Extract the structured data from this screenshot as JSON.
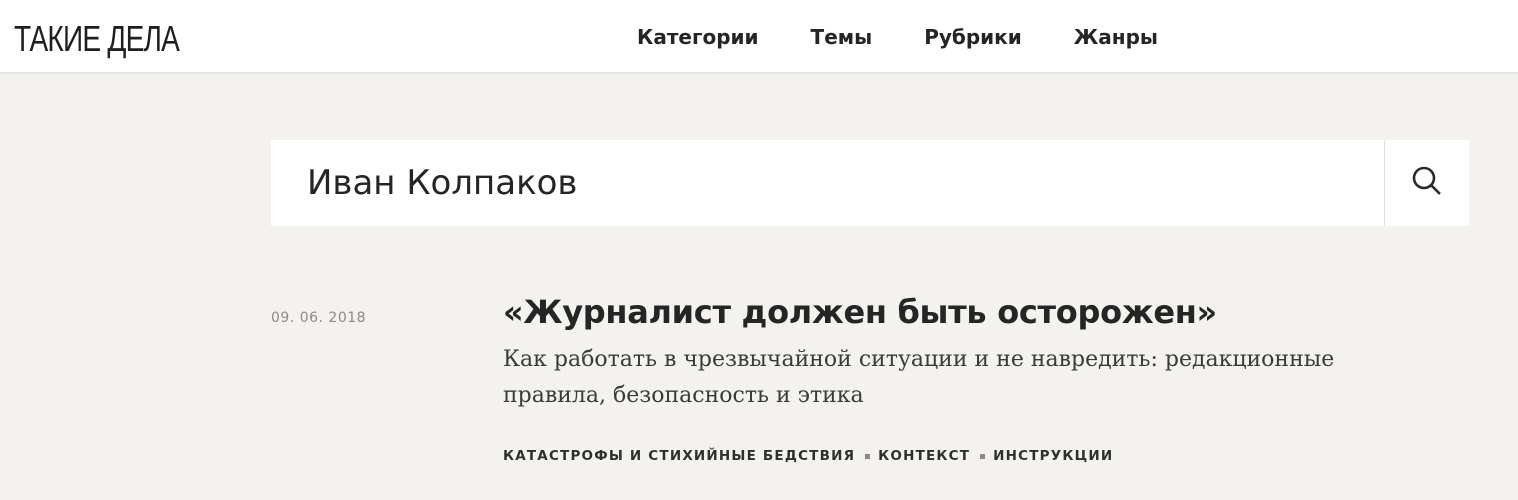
{
  "header": {
    "logo": "ТАКИЕ ДЕЛА",
    "nav": [
      "Категории",
      "Темы",
      "Рубрики",
      "Жанры"
    ]
  },
  "search": {
    "value": "Иван Колпаков",
    "button_icon": "search-icon"
  },
  "results": [
    {
      "date": "09. 06. 2018",
      "title": "«Журналист должен быть осторожен»",
      "lead": "Как работать в чрезвычайной ситуации и не навредить: редакционные правила, безопасность и этика",
      "tags": [
        "КАТАСТРОФЫ И СТИХИЙНЫЕ БЕДСТВИЯ",
        "КОНТЕКСТ",
        "ИНСТРУКЦИИ"
      ]
    }
  ],
  "colors": {
    "page_background": "#f3f2ee",
    "header_background": "#ffffff",
    "text": "#252525",
    "muted": "#8e8b85"
  }
}
